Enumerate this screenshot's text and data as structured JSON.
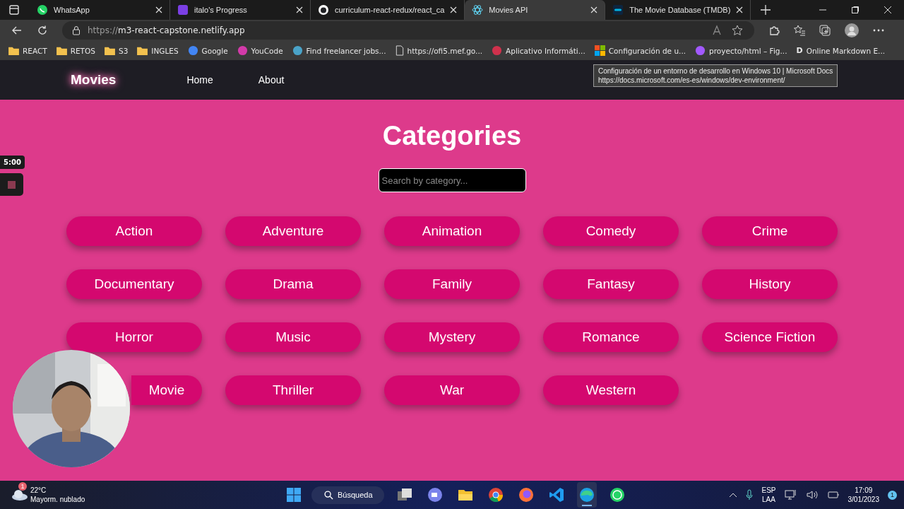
{
  "browser": {
    "tabs": [
      {
        "title": "WhatsApp",
        "selected": false
      },
      {
        "title": "italo's Progress",
        "selected": false
      },
      {
        "title": "curriculum-react-redux/react_ca",
        "selected": false
      },
      {
        "title": "Movies API",
        "selected": true
      },
      {
        "title": "The Movie Database (TMDB)",
        "selected": false
      }
    ],
    "url_scheme": "https://",
    "url_host": "m3-react-capstone.netlify.app",
    "bookmarks": [
      {
        "label": "REACT"
      },
      {
        "label": "RETOS"
      },
      {
        "label": "S3"
      },
      {
        "label": "INGLES"
      },
      {
        "label": "Google"
      },
      {
        "label": "YouCode"
      },
      {
        "label": "Find freelancer jobs..."
      },
      {
        "label": "https://ofi5.mef.go..."
      },
      {
        "label": "Aplicativo Informáti..."
      },
      {
        "label": "Configuración de u..."
      },
      {
        "label": "proyecto/html – Fig..."
      },
      {
        "label": "Online Markdown E...",
        "letter": "D"
      }
    ],
    "tooltip": {
      "title": "Configuración de un entorno de desarrollo en Windows 10 | Microsoft Docs",
      "url": "https://docs.microsoft.com/es-es/windows/dev-environment/"
    }
  },
  "page": {
    "logo": "Movies",
    "nav": [
      {
        "label": "Home"
      },
      {
        "label": "About"
      }
    ],
    "heading": "Categories",
    "search": {
      "placeholder": "Search by category..."
    },
    "categories": [
      {
        "label": "Action"
      },
      {
        "label": "Adventure"
      },
      {
        "label": "Animation"
      },
      {
        "label": "Comedy"
      },
      {
        "label": "Crime"
      },
      {
        "label": "Documentary"
      },
      {
        "label": "Drama"
      },
      {
        "label": "Family"
      },
      {
        "label": "Fantasy"
      },
      {
        "label": "History"
      },
      {
        "label": "Horror"
      },
      {
        "label": "Music"
      },
      {
        "label": "Mystery"
      },
      {
        "label": "Romance"
      },
      {
        "label": "Science Fiction"
      },
      {
        "label": "Movie",
        "partly_hidden": true
      },
      {
        "label": "Thriller"
      },
      {
        "label": "War"
      },
      {
        "label": "Western"
      }
    ]
  },
  "recorder": {
    "timer": "5:00"
  },
  "taskbar": {
    "weather": {
      "badge": "1",
      "temperature": "22°C",
      "condition": "Mayorm. nublado"
    },
    "search": "Búsqueda",
    "apps": [
      {
        "selected": false
      },
      {
        "selected": false
      },
      {
        "selected": false
      },
      {
        "selected": false
      },
      {
        "selected": false
      },
      {
        "selected": false
      },
      {
        "selected": true
      },
      {
        "selected": false
      }
    ],
    "language": "ESP",
    "layout": "LAA",
    "time": "17:09",
    "date": "3/01/2023",
    "notifications": "1"
  }
}
